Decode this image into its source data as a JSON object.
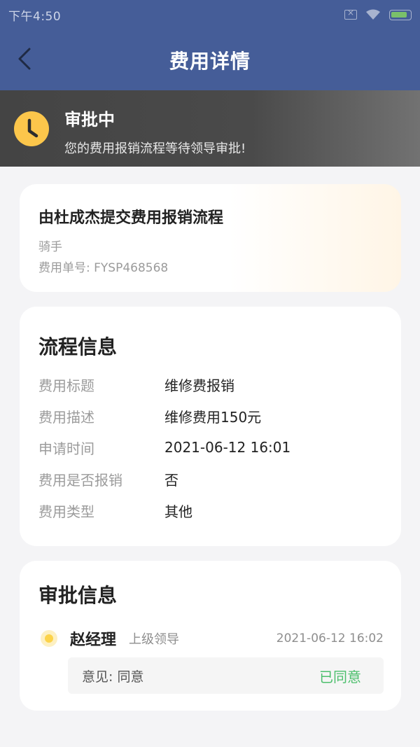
{
  "status_bar": {
    "time": "下午4:50"
  },
  "nav": {
    "title": "费用详情"
  },
  "banner": {
    "title": "审批中",
    "subtitle": "您的费用报销流程等待领导审批!"
  },
  "summary": {
    "title": "由杜成杰提交费用报销流程",
    "role": "骑手",
    "number_label": "费用单号: ",
    "number": "FYSP468568"
  },
  "process": {
    "title": "流程信息",
    "rows": [
      {
        "label": "费用标题",
        "value": "维修费报销"
      },
      {
        "label": "费用描述",
        "value": "维修费用150元"
      },
      {
        "label": "申请时间",
        "value": "2021-06-12 16:01"
      },
      {
        "label": "费用是否报销",
        "value": "否"
      },
      {
        "label": "费用类型",
        "value": "其他"
      }
    ]
  },
  "approval": {
    "title": "审批信息",
    "approver": {
      "name": "赵经理",
      "role": "上级领导",
      "time": "2021-06-12 16:02",
      "opinion": "意见: 同意",
      "status": "已同意"
    }
  },
  "colors": {
    "header": "#455d98",
    "banner": "#444444",
    "approved": "#4cbf6c",
    "clock": "#fcc64b"
  },
  "icons": [
    "back-icon",
    "clock-icon",
    "wifi-icon",
    "battery-icon",
    "sim-icon",
    "dot-icon"
  ]
}
